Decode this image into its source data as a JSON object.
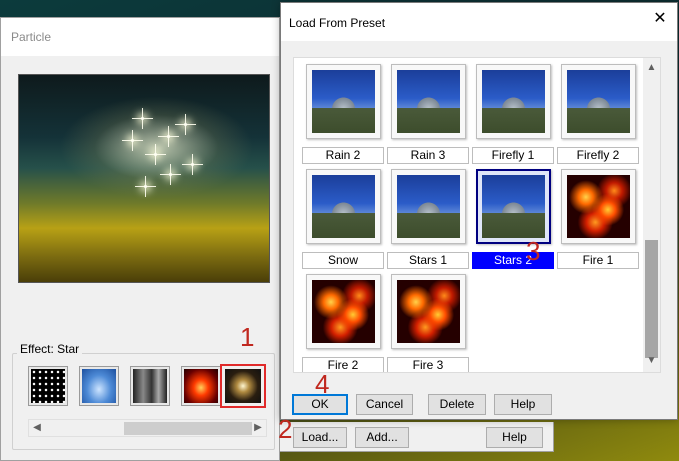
{
  "particle_dialog": {
    "title": "Particle",
    "effect_label": "Effect: Star",
    "effect_thumbs": [
      "snow",
      "sky",
      "smoke",
      "fire",
      "star"
    ],
    "selected_effect_index": 4,
    "buttons": {
      "load": "Load...",
      "add": "Add...",
      "help": "Help"
    }
  },
  "preset_dialog": {
    "title": "Load From Preset",
    "close_glyph": "✕",
    "presets": [
      {
        "label": "Rain 2",
        "style": "church"
      },
      {
        "label": "Rain 3",
        "style": "church"
      },
      {
        "label": "Firefly 1",
        "style": "church"
      },
      {
        "label": "Firefly 2",
        "style": "church"
      },
      {
        "label": "Snow",
        "style": "church"
      },
      {
        "label": "Stars 1",
        "style": "church"
      },
      {
        "label": "Stars 2",
        "style": "church",
        "selected": true
      },
      {
        "label": "Fire 1",
        "style": "fire"
      },
      {
        "label": "Fire 2",
        "style": "fire"
      },
      {
        "label": "Fire 3",
        "style": "fire"
      }
    ],
    "buttons": {
      "ok": "OK",
      "cancel": "Cancel",
      "delete": "Delete",
      "help": "Help"
    }
  },
  "step_markers": {
    "one": "1",
    "two": "2",
    "three": "3",
    "four": "4"
  },
  "colors": {
    "selection": "#0000ff",
    "marker": "#c0281f",
    "selected_border": "#000080"
  }
}
